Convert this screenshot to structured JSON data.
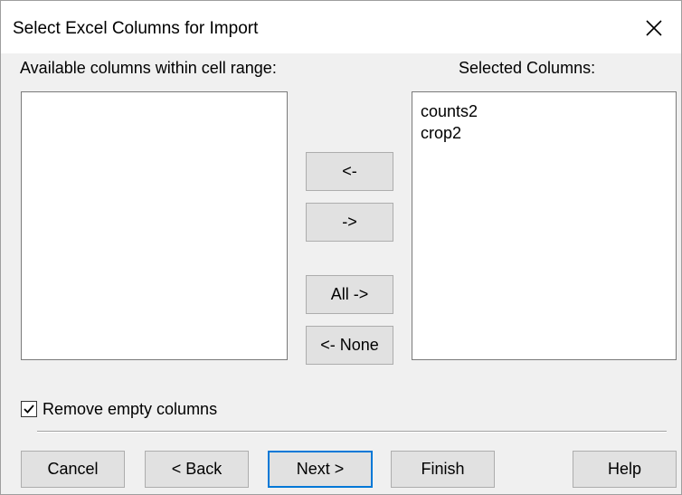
{
  "window": {
    "title": "Select Excel Columns for Import",
    "close_icon": "close-icon"
  },
  "labels": {
    "available": "Available columns within cell range:",
    "selected": "Selected Columns:"
  },
  "available_columns": [],
  "selected_columns": [
    "counts2",
    "crop2"
  ],
  "transfer_buttons": {
    "remove": "<-",
    "add": "->",
    "add_all": "All ->",
    "remove_all": "<- None"
  },
  "options": {
    "remove_empty_label": "Remove empty columns",
    "remove_empty_checked": true
  },
  "footer": {
    "cancel": "Cancel",
    "back": "< Back",
    "next": "Next >",
    "finish": "Finish",
    "help": "Help"
  },
  "colors": {
    "dialog_bg": "#f0f0f0",
    "default_button_border": "#0078d7"
  }
}
